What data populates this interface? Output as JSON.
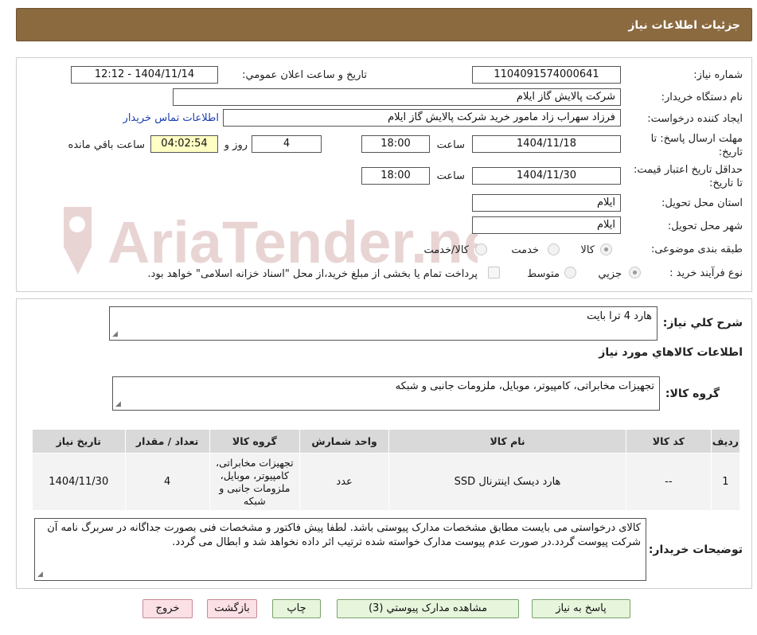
{
  "header": {
    "title": "جزئیات اطلاعات نیاز"
  },
  "watermark": {
    "text": "AriaTender.neT"
  },
  "form": {
    "need_number_label": "شماره نیاز:",
    "need_number": "1104091574000641",
    "announce_label": "تاریخ و ساعت اعلان عمومي:",
    "announce_value": "1404/11/14 - 12:12",
    "buyer_org_label": "نام دستگاه خريدار:",
    "buyer_org": "شرکت پالايش گاز ايلام",
    "creator_label": "ايجاد کننده درخواست:",
    "creator": "فرزاد سهراب زاد مامور خرید شرکت پالایش گاز ایلام",
    "contact_link": "اطلاعات تماس خريدار",
    "deadline_label": "مهلت ارسال پاسخ: تا تاريخ:",
    "deadline_date": "1404/11/18",
    "time_label": "ساعت",
    "deadline_time": "18:00",
    "days_value": "4",
    "days_label": "روز و",
    "remaining_time": "04:02:54",
    "remaining_label": "ساعت باقي مانده",
    "validity_label": "حداقل تاريخ اعتبار قيمت: تا تاريخ:",
    "validity_date": "1404/11/30",
    "validity_time": "18:00",
    "province_label": "استان محل تحويل:",
    "province": "ايلام",
    "city_label": "شهر محل تحويل:",
    "city": "ايلام",
    "category_label": "طبقه بندی موضوعی:",
    "category_options": [
      "کالا",
      "خدمت",
      "کالا/خدمت"
    ],
    "process_label": "نوع فرآيند خريد :",
    "process_options": [
      "جزيي",
      "متوسط"
    ],
    "payment_note": "پرداخت تمام یا بخشی از مبلغ خرید،از محل \"اسناد خزانه اسلامی\" خواهد بود."
  },
  "description": {
    "label": "شرح کلي نياز:",
    "value": "هارد 4 ترا بایت"
  },
  "goods_section": {
    "title": "اطلاعات کالاهاي مورد نياز",
    "group_label": "گروه کالا:",
    "group_value": "تجهیزات مخابراتی، کامپیوتر، موبایل، ملزومات جانبی و شبکه"
  },
  "table": {
    "headers": [
      "رديف",
      "کد کالا",
      "نام کالا",
      "واحد شمارش",
      "گروه کالا",
      "تعداد / مقدار",
      "تاريخ نياز"
    ],
    "rows": [
      [
        "1",
        "--",
        "هارد دیسک اینترنال SSD",
        "عدد",
        "تجهیزات مخابراتی، کامپیوتر، موبایل، ملزومات جانبی و شبکه",
        "4",
        "1404/11/30"
      ]
    ]
  },
  "buyer_notes": {
    "label": "توضيحات خريدار:",
    "value": "کالای درخواستی می بایست مطابق مشخصات مدارک پیوستی باشد. لطفا پیش فاکتور و مشخصات فنی بصورت جداگانه در سربرگ نامه آن شرکت پیوست گردد.در صورت عدم پیوست مدارک خواسته شده ترتیب اثر داده نخواهد شد و ابطال می گردد."
  },
  "buttons": {
    "reply": "پاسخ به نياز",
    "attachments": "مشاهده مدارک پيوستي (3)",
    "print": "چاپ",
    "back": "بازگشت",
    "exit": "خروج"
  }
}
